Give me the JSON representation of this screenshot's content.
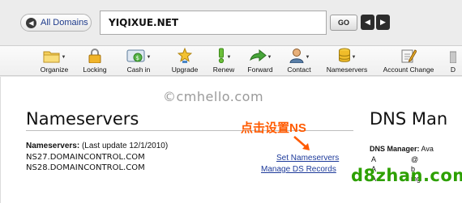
{
  "topbar": {
    "all_domains_label": "All Domains",
    "domain_value": "YIQIXUE.NET",
    "go_label": "GO",
    "prev_glyph": "◀",
    "next_glyph": "▶"
  },
  "toolbar": {
    "items": [
      {
        "label": "Organize",
        "icon": "folder-icon",
        "has_caret": true
      },
      {
        "label": "Locking",
        "icon": "lock-icon",
        "has_caret": false
      },
      {
        "label": "Cash in",
        "icon": "cash-in-icon",
        "has_caret": true
      },
      {
        "label": "Upgrade",
        "icon": "upgrade-star-icon",
        "has_caret": false
      },
      {
        "label": "Renew",
        "icon": "renew-exclamation-icon",
        "has_caret": true
      },
      {
        "label": "Forward",
        "icon": "forward-arrow-icon",
        "has_caret": true
      },
      {
        "label": "Contact",
        "icon": "contact-person-icon",
        "has_caret": true
      },
      {
        "label": "Nameservers",
        "icon": "nameservers-db-icon",
        "has_caret": true
      },
      {
        "label": "Account Change",
        "icon": "account-change-icon",
        "has_caret": false
      },
      {
        "label": "D",
        "icon": "truncated-icon",
        "has_caret": false
      }
    ]
  },
  "nameservers": {
    "title": "Nameservers",
    "label": "Nameservers:",
    "last_update": "(Last update 12/1/2010)",
    "servers": [
      "NS27.DOMAINCONTROL.COM",
      "NS28.DOMAINCONTROL.COM"
    ],
    "set_link": "Set Nameservers",
    "manage_ds_link": "Manage DS Records"
  },
  "dns": {
    "title": "DNS Man",
    "label": "DNS Manager:",
    "label_rest": "Ava",
    "rows": [
      {
        "col1": "A",
        "col2": "@"
      },
      {
        "col1": "A",
        "col2": "b"
      },
      {
        "col1": "A",
        "col2": "ing"
      }
    ]
  },
  "overlays": {
    "watermark": "©cmhello.com",
    "annotation": "点击设置NS",
    "watermark2": "d8zhan.com"
  },
  "colors": {
    "link": "#1d3a9a",
    "annotation": "#ff5a00",
    "watermark2": "#2da000"
  }
}
